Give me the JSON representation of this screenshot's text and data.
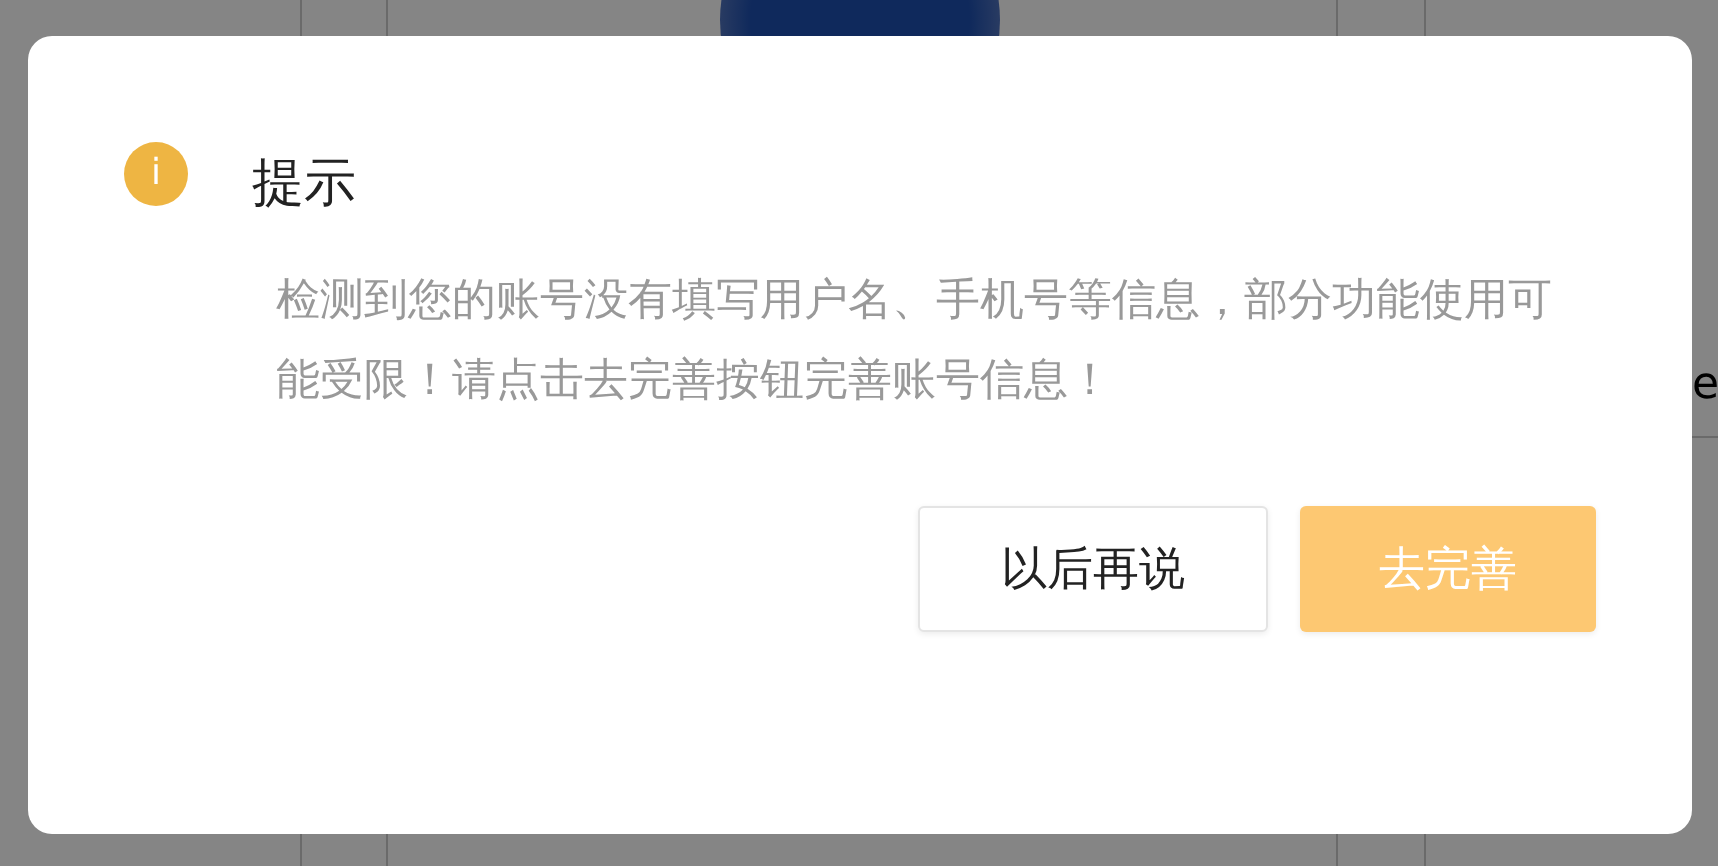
{
  "background": {
    "text_fragment": "e"
  },
  "dialog": {
    "icon": "i",
    "title": "提示",
    "message": "检测到您的账号没有填写用户名、手机号等信息，部分功能使用可能受限！请点击去完善按钮完善账号信息！",
    "buttons": [
      {
        "label": "以后再说",
        "kind": "secondary"
      },
      {
        "label": "去完善",
        "kind": "primary"
      }
    ]
  }
}
